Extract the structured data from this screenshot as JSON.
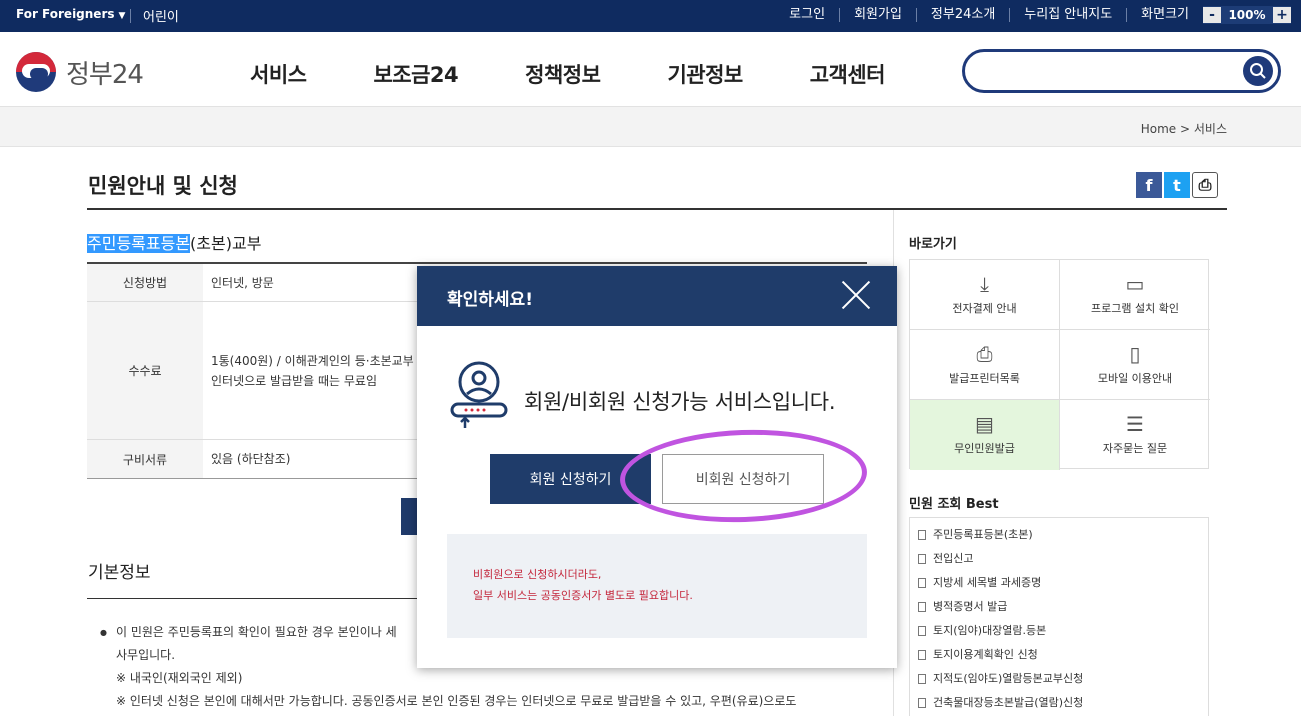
{
  "topbar": {
    "lang": "For Foreigners",
    "kids": "어린이",
    "links": [
      "로그인",
      "회원가입",
      "정부24소개",
      "누리집 안내지도",
      "화면크기"
    ],
    "zoom_minus": "-",
    "zoom_value": "100%",
    "zoom_plus": "+"
  },
  "header": {
    "logo_text": "정부24",
    "nav": [
      "서비스",
      "보조금24",
      "정책정보",
      "기관정보",
      "고객센터"
    ],
    "search_placeholder": ""
  },
  "breadcrumb": {
    "home": "Home",
    "separator": ">",
    "current": "서비스"
  },
  "page": {
    "title": "민원안내 및 신청",
    "service_title_highlight": "주민등록표등본",
    "service_title_rest": "(초본)교부",
    "table": [
      {
        "label": "신청방법",
        "value": [
          "인터넷, 방문"
        ]
      },
      {
        "label": "수수료",
        "value": [
          "1통(400원) / 이해관계인의 등·초본교부",
          "인터넷으로 발급받을 때는 무료임"
        ]
      },
      {
        "label": "구비서류",
        "value": [
          "있음 (하단참조)"
        ]
      }
    ],
    "basic_title": "기본정보",
    "basic_lines": [
      "이 민원은 주민등록표의 확인이 필요한 경우 본인이나 세",
      "사무입니다.",
      "※ 내국인(재외국인 제외)",
      "※ 인터넷 신청은 본인에 대해서만 가능합니다. 공동인증서로 본인 인증된 경우는 인터넷으로 무료로 발급받을 수 있고, 우편(유료)으로도"
    ]
  },
  "share": {
    "facebook": "f",
    "twitter": "t",
    "print": "⎙"
  },
  "sidebar": {
    "quick_title": "바로가기",
    "quick": [
      {
        "label": "전자결제 안내",
        "icon": "download-icon"
      },
      {
        "label": "프로그램 설치 확인",
        "icon": "monitor-icon"
      },
      {
        "label": "발급프린터목록",
        "icon": "printer-icon"
      },
      {
        "label": "모바일 이용안내",
        "icon": "mobile-icon"
      },
      {
        "label": "무인민원발급",
        "icon": "kiosk-icon"
      },
      {
        "label": "자주묻는 질문",
        "icon": "chat-icon"
      }
    ],
    "best_title": "민원 조회 Best",
    "best": [
      "주민등록표등본(초본)",
      "전입신고",
      "지방세 세목별 과세증명",
      "병적증명서 발급",
      "토지(임야)대장열람.등본",
      "토지이용계획확인 신청",
      "지적도(임야도)열람등본교부신청",
      "건축물대장등초본발급(열람)신청"
    ]
  },
  "modal": {
    "title": "확인하세요!",
    "message": "회원/비회원 신청가능 서비스입니다.",
    "member_button": "회원 신청하기",
    "guest_button": "비회원 신청하기",
    "notice_line1": "비회원으로 신청하시더라도,",
    "notice_line2": "일부 서비스는 공동인증서가 별도로 필요합니다."
  },
  "colors": {
    "navy": "#0f2b60",
    "modal_header": "#1f3c6a",
    "highlight_ring": "#c054e0",
    "notice_text": "#c4263b"
  }
}
